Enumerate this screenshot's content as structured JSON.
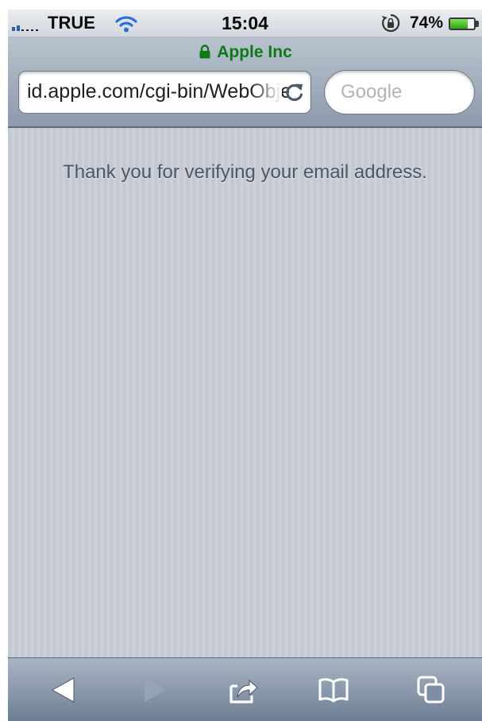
{
  "status_bar": {
    "carrier": "TRUE",
    "time": "15:04",
    "battery_percent": "74%",
    "battery_level": 0.74,
    "icons": [
      "signal-icon",
      "wifi-icon",
      "rotation-lock-icon",
      "battery-icon"
    ]
  },
  "address_bar": {
    "page_owner": "Apple Inc",
    "url": "id.apple.com/cgi-bin/WebObjects",
    "search_placeholder": "Google"
  },
  "content": {
    "message": "Thank you for verifying your email address."
  },
  "toolbar": {
    "buttons": [
      "back-icon",
      "forward-icon",
      "share-icon",
      "bookmarks-icon",
      "tabs-icon"
    ]
  },
  "colors": {
    "secure_owner_green": "#0d7a16",
    "message_text": "#4b566b",
    "page_background": "#c5cad2"
  }
}
